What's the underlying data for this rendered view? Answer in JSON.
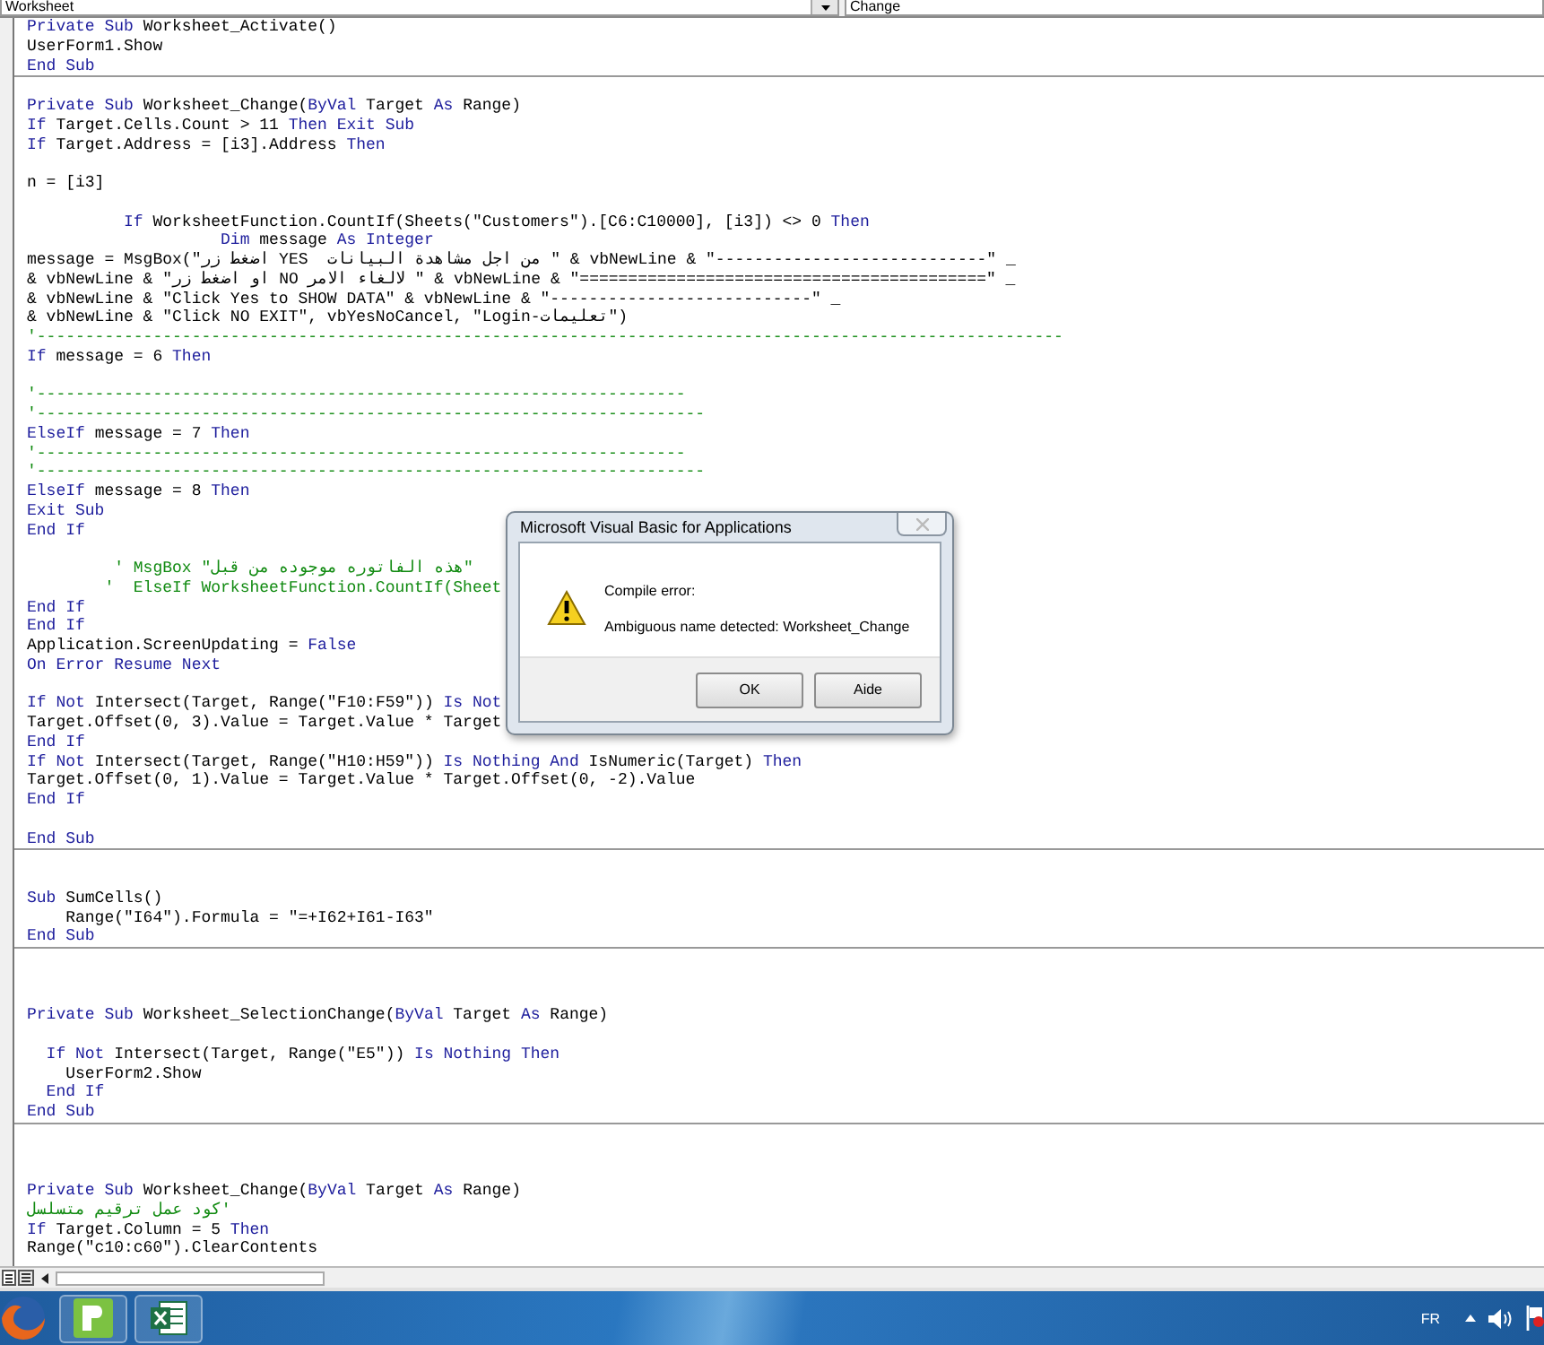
{
  "editor": {
    "object_dropdown": {
      "value": "Worksheet"
    },
    "procedure_dropdown": {
      "value": "Change"
    },
    "procedures": [
      {
        "lines": [
          {
            "kind": "code",
            "segments": [
              {
                "text": "Private Sub ",
                "keyword": true
              },
              {
                "text": "Worksheet_Activate()",
                "keyword": false
              }
            ]
          },
          {
            "kind": "code",
            "text": "UserForm1.Show"
          },
          {
            "kind": "keyword",
            "text": "End Sub"
          }
        ]
      },
      {
        "lines": [
          {
            "kind": "blank"
          },
          {
            "kind": "code",
            "segments": [
              {
                "text": "Private Sub ",
                "keyword": true
              },
              {
                "text": "Worksheet_Change(",
                "keyword": false
              },
              {
                "text": "ByVal ",
                "keyword": true
              },
              {
                "text": "Target ",
                "keyword": false
              },
              {
                "text": "As ",
                "keyword": true
              },
              {
                "text": "Range)",
                "keyword": false
              }
            ]
          },
          {
            "kind": "code",
            "segments": [
              {
                "text": "If ",
                "keyword": true
              },
              {
                "text": "Target.Cells.Count > 11 ",
                "keyword": false
              },
              {
                "text": "Then Exit Sub",
                "keyword": true
              }
            ]
          },
          {
            "kind": "code",
            "segments": [
              {
                "text": "If ",
                "keyword": true
              },
              {
                "text": "Target.Address = [i3].Address ",
                "keyword": false
              },
              {
                "text": "Then",
                "keyword": true
              }
            ]
          },
          {
            "kind": "blank"
          },
          {
            "kind": "code",
            "text": "n = [i3]"
          },
          {
            "kind": "blank"
          },
          {
            "kind": "code",
            "segments": [
              {
                "text": "          If ",
                "keyword": true
              },
              {
                "text": "WorksheetFunction.CountIf(Sheets(\"Customers\").[C6:C10000], [i3]) <> 0 ",
                "keyword": false
              },
              {
                "text": "Then",
                "keyword": true
              }
            ]
          },
          {
            "kind": "code",
            "segments": [
              {
                "text": "                    Dim ",
                "keyword": true
              },
              {
                "text": "message ",
                "keyword": false
              },
              {
                "text": "As Integer",
                "keyword": true
              }
            ]
          },
          {
            "kind": "code",
            "text": "message = MsgBox(\"اضغط زر YES  من اجل مشاهدة البيانات \" & vbNewLine & \"----------------------------\" _"
          },
          {
            "kind": "code",
            "text": "& vbNewLine & \"او اضغط زر NO لالغاء الامر \" & vbNewLine & \"==========================================\" _"
          },
          {
            "kind": "code",
            "text": "& vbNewLine & \"Click Yes to SHOW DATA\" & vbNewLine & \"---------------------------\" _"
          },
          {
            "kind": "code",
            "text": "& vbNewLine & \"Click NO EXIT\", vbYesNoCancel, \"Login-تعليمات\")"
          },
          {
            "kind": "comment",
            "text": "'----------------------------------------------------------------------------------------------------------"
          },
          {
            "kind": "code",
            "segments": [
              {
                "text": "If ",
                "keyword": true
              },
              {
                "text": "message = 6 ",
                "keyword": false
              },
              {
                "text": "Then",
                "keyword": true
              }
            ]
          },
          {
            "kind": "blank"
          },
          {
            "kind": "comment",
            "text": "'-------------------------------------------------------------------"
          },
          {
            "kind": "comment",
            "text": "'---------------------------------------------------------------------"
          },
          {
            "kind": "code",
            "segments": [
              {
                "text": "ElseIf ",
                "keyword": true
              },
              {
                "text": "message = 7 ",
                "keyword": false
              },
              {
                "text": "Then",
                "keyword": true
              }
            ]
          },
          {
            "kind": "comment",
            "text": "'-------------------------------------------------------------------"
          },
          {
            "kind": "comment",
            "text": "'---------------------------------------------------------------------"
          },
          {
            "kind": "code",
            "segments": [
              {
                "text": "ElseIf ",
                "keyword": true
              },
              {
                "text": "message = 8 ",
                "keyword": false
              },
              {
                "text": "Then",
                "keyword": true
              }
            ]
          },
          {
            "kind": "keyword",
            "text": "Exit Sub"
          },
          {
            "kind": "keyword",
            "text": "End If"
          },
          {
            "kind": "blank"
          },
          {
            "kind": "comment",
            "text": "         ' MsgBox \"هذه الفاتوره موجوده من قبل\""
          },
          {
            "kind": "comment",
            "text": "        '  ElseIf WorksheetFunction.CountIf(Sheet"
          },
          {
            "kind": "keyword",
            "text": "End If"
          },
          {
            "kind": "keyword",
            "text": "End If"
          },
          {
            "kind": "code",
            "segments": [
              {
                "text": "Application.ScreenUpdating = ",
                "keyword": false
              },
              {
                "text": "False",
                "keyword": true
              }
            ]
          },
          {
            "kind": "keyword",
            "text": "On Error Resume Next"
          },
          {
            "kind": "blank"
          },
          {
            "kind": "code",
            "segments": [
              {
                "text": "If Not ",
                "keyword": true
              },
              {
                "text": "Intersect(Target, Range(\"F10:F59\")) ",
                "keyword": false
              },
              {
                "text": "Is Not",
                "keyword": true
              }
            ]
          },
          {
            "kind": "code",
            "text": "Target.Offset(0, 3).Value = Target.Value * Target"
          },
          {
            "kind": "keyword",
            "text": "End If"
          },
          {
            "kind": "code",
            "segments": [
              {
                "text": "If Not ",
                "keyword": true
              },
              {
                "text": "Intersect(Target, Range(\"H10:H59\")) ",
                "keyword": false
              },
              {
                "text": "Is Nothing And ",
                "keyword": true
              },
              {
                "text": "IsNumeric(Target) ",
                "keyword": false
              },
              {
                "text": "Then",
                "keyword": true
              }
            ]
          },
          {
            "kind": "code",
            "text": "Target.Offset(0, 1).Value = Target.Value * Target.Offset(0, -2).Value"
          },
          {
            "kind": "keyword",
            "text": "End If"
          },
          {
            "kind": "blank"
          },
          {
            "kind": "keyword",
            "text": "End Sub"
          }
        ]
      },
      {
        "lines": [
          {
            "kind": "blank"
          },
          {
            "kind": "blank"
          },
          {
            "kind": "code",
            "segments": [
              {
                "text": "Sub ",
                "keyword": true
              },
              {
                "text": "SumCells()",
                "keyword": false
              }
            ]
          },
          {
            "kind": "code",
            "text": "    Range(\"I64\").Formula = \"=+I62+I61-I63\""
          },
          {
            "kind": "keyword",
            "text": "End Sub"
          }
        ]
      },
      {
        "lines": [
          {
            "kind": "blank"
          },
          {
            "kind": "blank"
          },
          {
            "kind": "blank"
          },
          {
            "kind": "code",
            "segments": [
              {
                "text": "Private Sub ",
                "keyword": true
              },
              {
                "text": "Worksheet_SelectionChange(",
                "keyword": false
              },
              {
                "text": "ByVal ",
                "keyword": true
              },
              {
                "text": "Target ",
                "keyword": false
              },
              {
                "text": "As ",
                "keyword": true
              },
              {
                "text": "Range)",
                "keyword": false
              }
            ]
          },
          {
            "kind": "blank"
          },
          {
            "kind": "code",
            "segments": [
              {
                "text": "  If Not ",
                "keyword": true
              },
              {
                "text": "Intersect(Target, Range(\"E5\")) ",
                "keyword": false
              },
              {
                "text": "Is Nothing Then",
                "keyword": true
              }
            ]
          },
          {
            "kind": "code",
            "text": "    UserForm2.Show"
          },
          {
            "kind": "keyword",
            "text": "  End If"
          },
          {
            "kind": "keyword",
            "text": "End Sub"
          }
        ]
      },
      {
        "lines": [
          {
            "kind": "blank"
          },
          {
            "kind": "blank"
          },
          {
            "kind": "blank"
          },
          {
            "kind": "code",
            "segments": [
              {
                "text": "Private Sub ",
                "keyword": true
              },
              {
                "text": "Worksheet_Change(",
                "keyword": false
              },
              {
                "text": "ByVal ",
                "keyword": true
              },
              {
                "text": "Target ",
                "keyword": false
              },
              {
                "text": "As ",
                "keyword": true
              },
              {
                "text": "Range)",
                "keyword": false
              }
            ]
          },
          {
            "kind": "comment",
            "text": "'كود عمل ترقيم متسلسل"
          },
          {
            "kind": "code",
            "segments": [
              {
                "text": "If ",
                "keyword": true
              },
              {
                "text": "Target.Column = 5 ",
                "keyword": false
              },
              {
                "text": "Then",
                "keyword": true
              }
            ]
          },
          {
            "kind": "code",
            "text": "Range(\"c10:c60\").ClearContents"
          }
        ]
      }
    ]
  },
  "dialog": {
    "title": "Microsoft Visual Basic for Applications",
    "heading": "Compile error:",
    "message": "Ambiguous name detected: Worksheet_Change",
    "buttons": [
      {
        "label": "OK"
      },
      {
        "label": "Aide"
      }
    ]
  },
  "taskbar": {
    "language": "FR"
  }
}
